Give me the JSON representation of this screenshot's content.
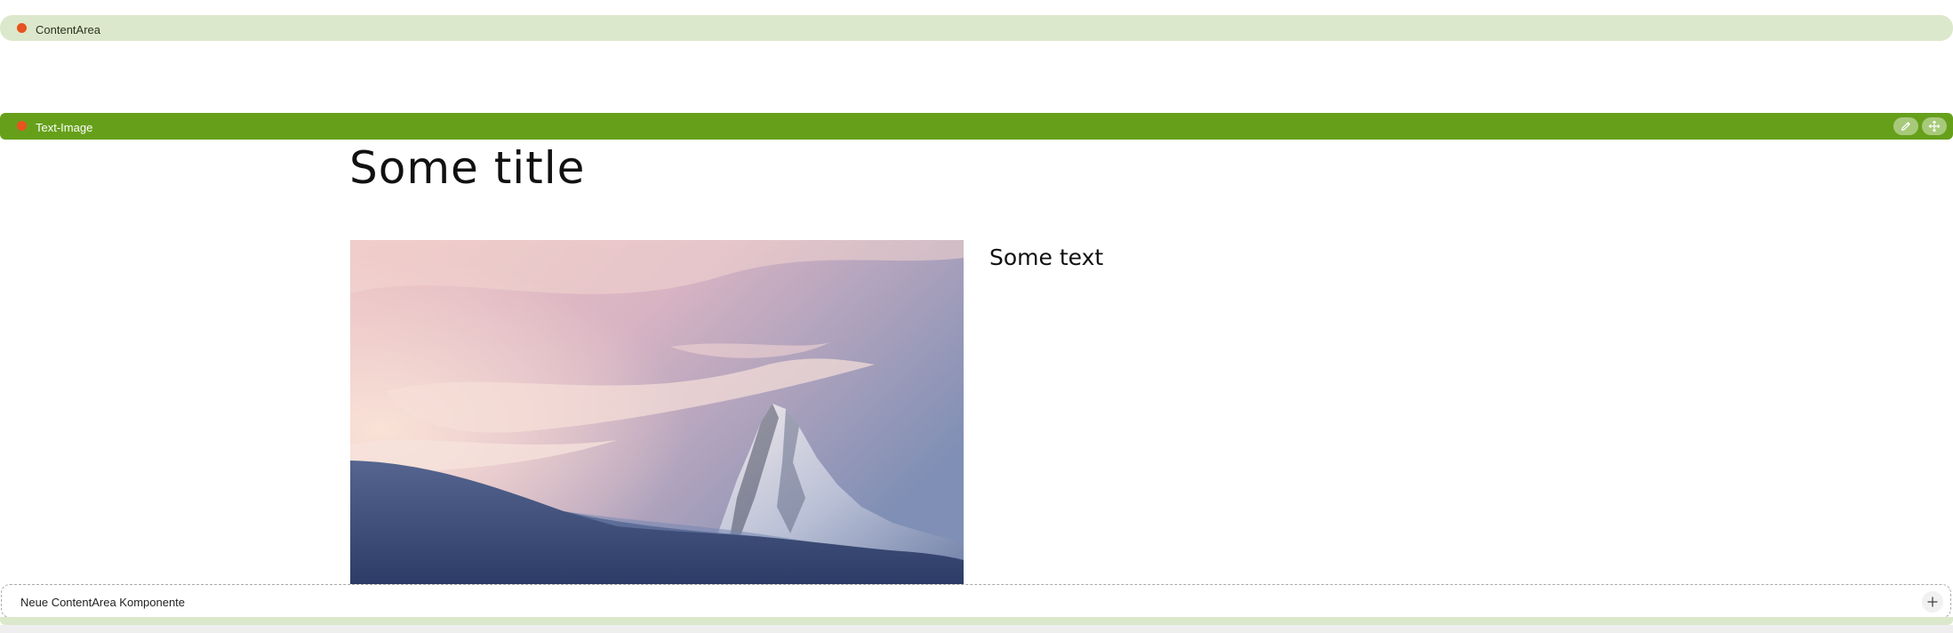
{
  "content_area": {
    "label": "ContentArea",
    "dot_color": "#e8531f",
    "bar_color": "#dce8cb"
  },
  "component": {
    "label": "Text-Image",
    "bar_color": "#66a01b",
    "dot_color": "#e8531f",
    "actions": [
      {
        "icon": "pencil-icon"
      },
      {
        "icon": "move-arrows-icon"
      }
    ]
  },
  "content": {
    "title": "Some title",
    "text": "Some text",
    "image": {
      "depicts": "snowy mountain peak at sunset with pink clouds"
    }
  },
  "new_component": {
    "label": "Neue ContentArea Komponente",
    "icon": "plus-icon"
  }
}
